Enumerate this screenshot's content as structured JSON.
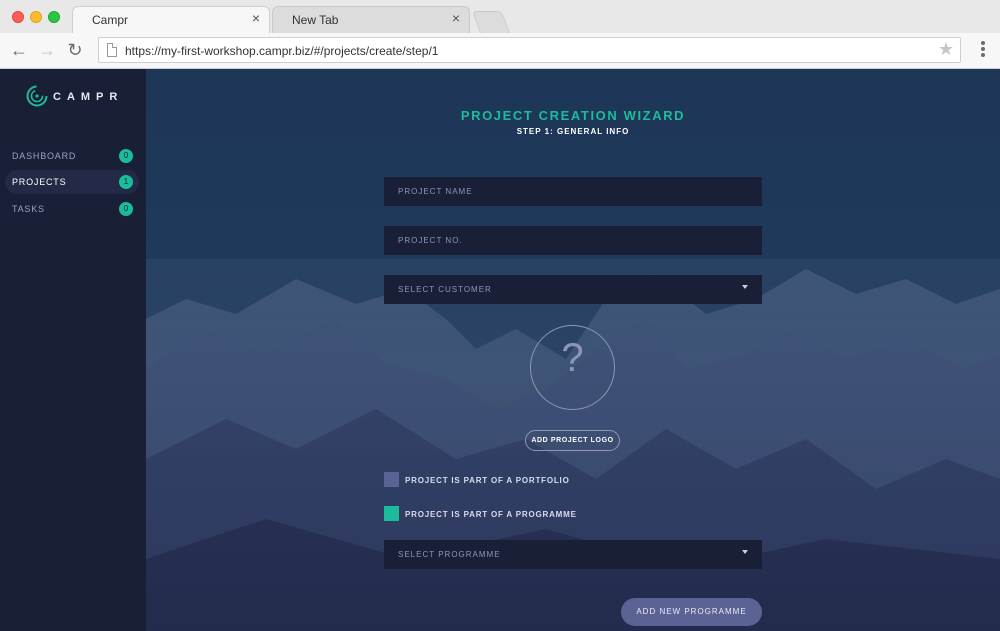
{
  "browser": {
    "tabs": [
      {
        "label": "Campr",
        "close": "×"
      },
      {
        "label": "New Tab",
        "close": "×"
      }
    ],
    "url": "https://my-first-workshop.campr.biz/#/projects/create/step/1",
    "nav": {
      "back": "←",
      "forward": "→",
      "reload": "↻"
    },
    "bookmark": "★"
  },
  "app": {
    "logo_text": "CAMPR",
    "accent_color": "#1abc9c",
    "sidebar_bg": "#191f37",
    "nav": [
      {
        "label": "DASHBOARD",
        "count": "0",
        "active": false
      },
      {
        "label": "PROJECTS",
        "count": "1",
        "active": true
      },
      {
        "label": "TASKS",
        "count": "0",
        "active": false
      }
    ]
  },
  "wizard": {
    "title": "PROJECT CREATION WIZARD",
    "subtitle": "STEP 1: GENERAL INFO",
    "fields": {
      "project_name": "PROJECT NAME",
      "project_no": "PROJECT NO.",
      "customer": "SELECT CUSTOMER",
      "programme": "SELECT PROGRAMME"
    },
    "logo_placeholder": "?",
    "add_logo": "ADD PROJECT LOGO",
    "checks": {
      "portfolio": {
        "label": "PROJECT IS PART OF A PORTFOLIO",
        "checked": false
      },
      "programme": {
        "label": "PROJECT IS PART OF A PROGRAMME",
        "checked": true
      }
    },
    "add_programme": "ADD NEW PROGRAMME"
  }
}
